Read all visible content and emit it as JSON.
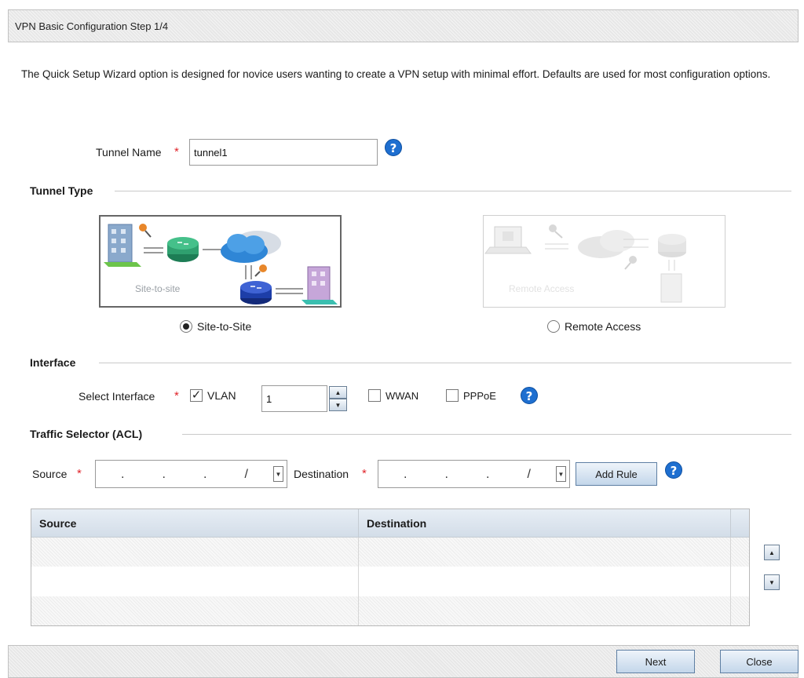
{
  "header": {
    "title": "VPN Basic Configuration  Step 1/4"
  },
  "intro": {
    "text": "The Quick Setup Wizard option is designed for novice users wanting to create a VPN setup with minimal effort. Defaults are used for most configuration options."
  },
  "tunnel_name": {
    "label": "Tunnel Name",
    "value": "tunnel1"
  },
  "tunnel_type": {
    "section_title": "Tunnel Type",
    "options": [
      {
        "label": "Site-to-Site",
        "caption": "Site-to-site",
        "selected": true
      },
      {
        "label": "Remote Access",
        "caption": "Remote Access",
        "selected": false
      }
    ]
  },
  "interface": {
    "section_title": "Interface",
    "select_label": "Select Interface",
    "vlan_label": "VLAN",
    "vlan_checked": true,
    "vlan_value": "1",
    "wwan_label": "WWAN",
    "wwan_checked": false,
    "pppoe_label": "PPPoE",
    "pppoe_checked": false
  },
  "traffic_selector": {
    "section_title": "Traffic Selector (ACL)",
    "source_label": "Source",
    "destination_label": "Destination",
    "add_rule_label": "Add Rule"
  },
  "rules_table": {
    "columns": [
      "Source",
      "Destination"
    ],
    "rows": []
  },
  "footer": {
    "next_label": "Next",
    "close_label": "Close"
  },
  "colors": {
    "required": "#e0242a",
    "help": "#1e6fd0",
    "button_border": "#5e7fa3"
  }
}
